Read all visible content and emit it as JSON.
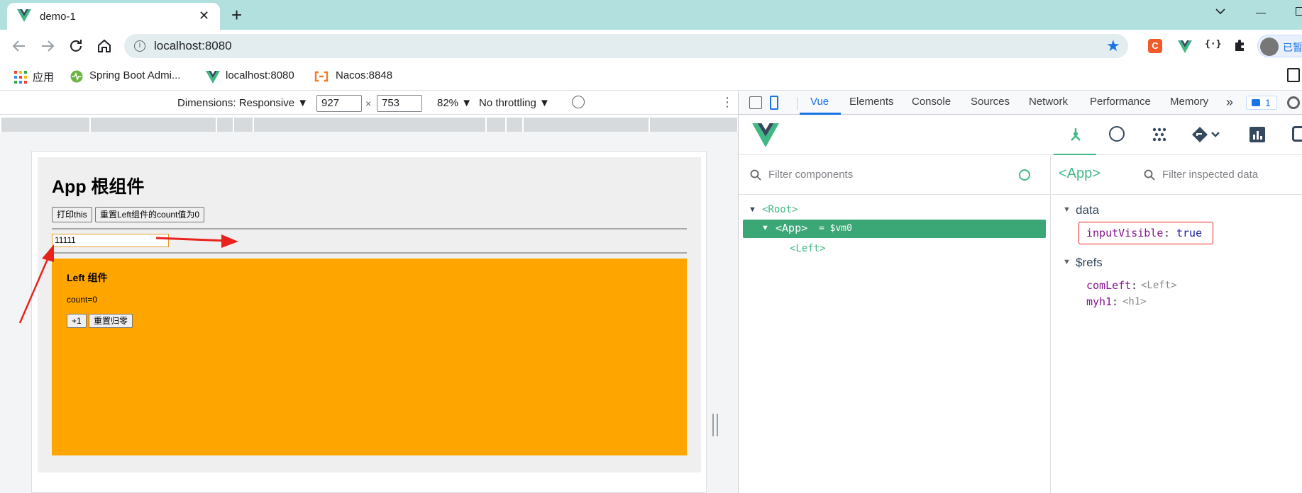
{
  "browser": {
    "tab_title": "demo-1",
    "address": "localhost:8080",
    "bookmarks": [
      {
        "label": "应用"
      },
      {
        "label": "Spring Boot Admi..."
      },
      {
        "label": "localhost:8080"
      },
      {
        "label": "Nacos:8848"
      }
    ],
    "profile_label": "已暂"
  },
  "device_toolbar": {
    "dimensions_label": "Dimensions: Responsive ▼",
    "width": "927",
    "times": "×",
    "height": "753",
    "zoom": "82% ▼",
    "throttling": "No throttling ▼"
  },
  "app": {
    "title": "App 根组件",
    "print_button": "打印this",
    "reset_button": "重置Left组件的count值为0",
    "input_value": "11111",
    "left": {
      "title": "Left 组件",
      "count_text": "count=0",
      "plus_button": "+1",
      "reset_button": "重置归零"
    }
  },
  "devtools": {
    "tabs": [
      "Vue",
      "Elements",
      "Console",
      "Sources",
      "Network",
      "Performance",
      "Memory"
    ],
    "more": "»",
    "issues_count": "1",
    "filter_components_placeholder": "Filter components",
    "tree": {
      "root": "<Root>",
      "app": "<App>",
      "app_suffix": "= $vm0",
      "left": "<Left>"
    },
    "inspector_title": "<App>",
    "filter_inspected_placeholder": "Filter inspected data",
    "data_section": "data",
    "input_visible_key": "inputVisible",
    "input_visible_value": "true",
    "refs_section": "$refs",
    "ref_comleft_key": "comLeft",
    "ref_comleft_value": "<Left>",
    "ref_myh1_key": "myh1",
    "ref_myh1_value": "<h1>"
  },
  "colors": {
    "tabstrip": "#b1e0df",
    "vue_green": "#41b883",
    "orange": "#ffa500",
    "annotation_red": "#e8231e"
  }
}
